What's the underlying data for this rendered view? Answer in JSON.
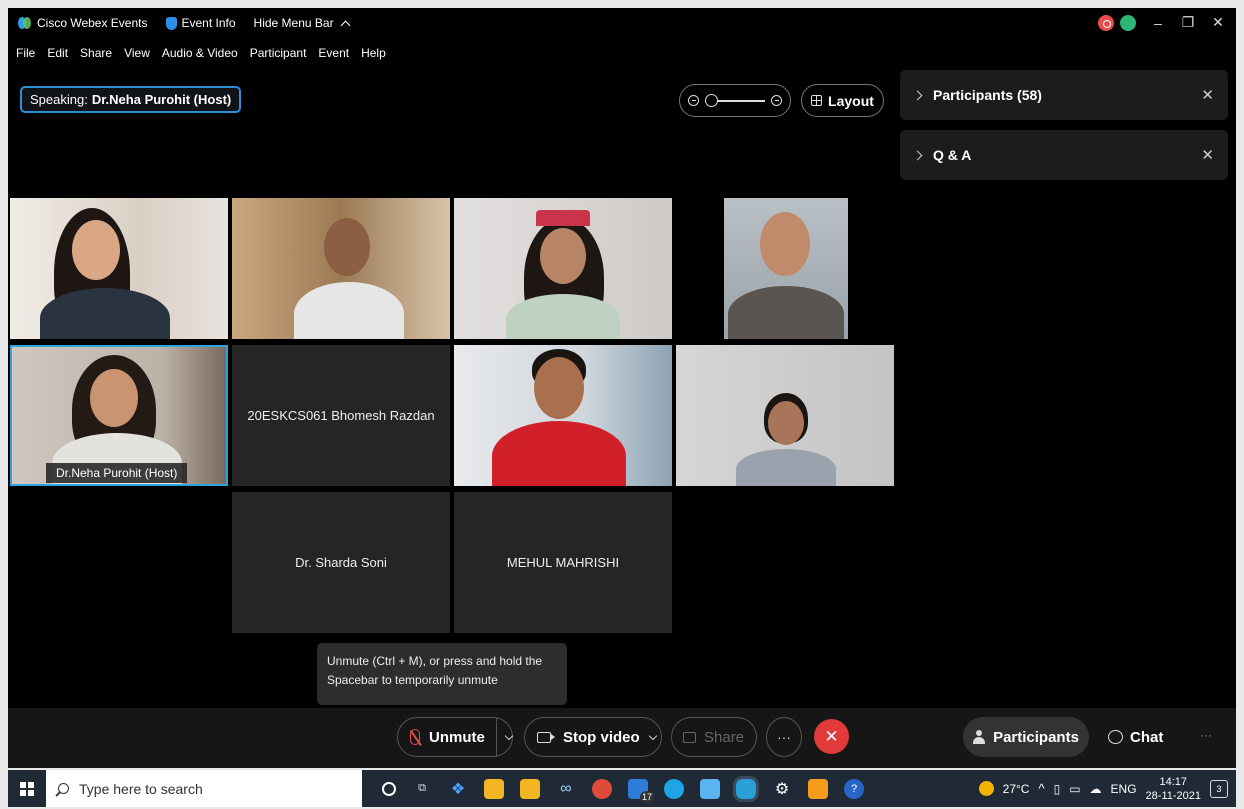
{
  "titlebar": {
    "app_name": "Cisco Webex Events",
    "event_info": "Event Info",
    "hide_menu_bar": "Hide Menu Bar"
  },
  "menu": [
    "File",
    "Edit",
    "Share",
    "View",
    "Audio & Video",
    "Participant",
    "Event",
    "Help"
  ],
  "speaking": {
    "label": "Speaking:",
    "name": "Dr.Neha Purohit (Host)"
  },
  "layout_label": "Layout",
  "panels": {
    "participants": "Participants (58)",
    "qa": "Q & A"
  },
  "tiles": {
    "host_name_tag": "Dr.Neha Purohit  (Host)",
    "bhomesh": "20ESKCS061 Bhomesh Razdan",
    "sharda": "Dr. Sharda Soni",
    "mehul": "MEHUL MAHRISHI"
  },
  "tooltip": "Unmute (Ctrl + M), or press and hold the Spacebar to temporarily unmute",
  "controls": {
    "unmute": "Unmute",
    "stop_video": "Stop video",
    "share": "Share",
    "participants": "Participants",
    "chat": "Chat"
  },
  "taskbar": {
    "search_placeholder": "Type here to search",
    "temperature": "27°C",
    "language": "ENG",
    "time": "14:17",
    "date": "28-11-2021",
    "notification_count": "3",
    "badge_count": "17"
  },
  "colors": {
    "accent_blue": "#2d8fd8",
    "end_call_red": "#e03a3a",
    "mute_red": "#e84d4d"
  }
}
